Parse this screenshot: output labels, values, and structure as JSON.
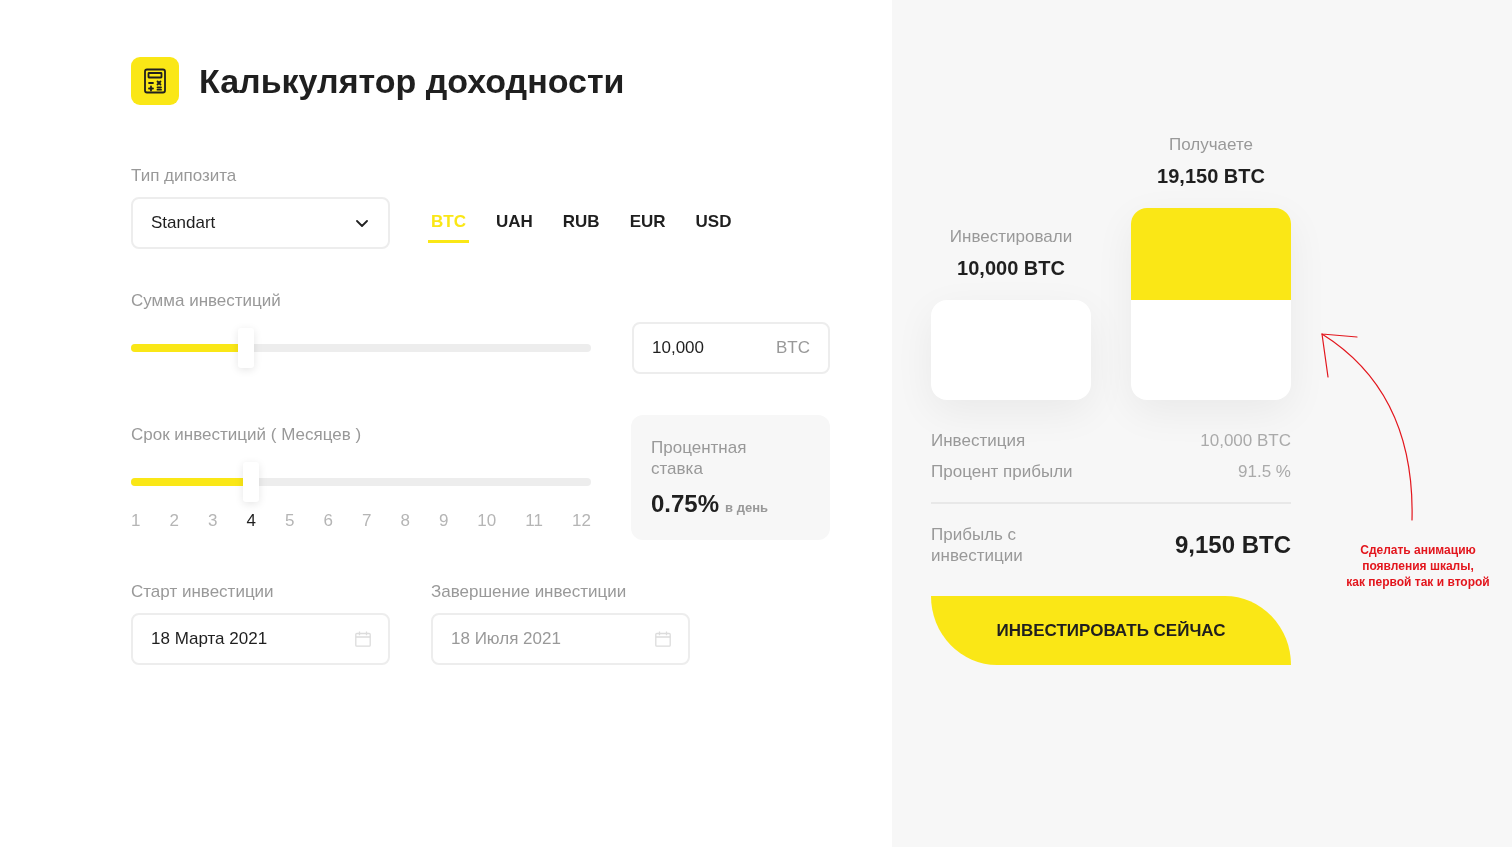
{
  "title": "Калькулятор доходности",
  "deposit": {
    "label": "Тип дипозита",
    "value": "Standart"
  },
  "currencies": [
    {
      "label": "BTC",
      "selected": true
    },
    {
      "label": "UAH",
      "selected": false
    },
    {
      "label": "RUB",
      "selected": false
    },
    {
      "label": "EUR",
      "selected": false
    },
    {
      "label": "USD",
      "selected": false
    }
  ],
  "amount": {
    "label": "Сумма инвестиций",
    "level": 0.25,
    "value": "10,000",
    "unit": "BTC"
  },
  "term": {
    "label": "Срок инвестиций ( Месяцев )",
    "level": 0.26,
    "ticks": [
      {
        "label": "1",
        "selected": false
      },
      {
        "label": "2",
        "selected": false
      },
      {
        "label": "3",
        "selected": false
      },
      {
        "label": "4",
        "selected": true
      },
      {
        "label": "5",
        "selected": false
      },
      {
        "label": "6",
        "selected": false
      },
      {
        "label": "7",
        "selected": false
      },
      {
        "label": "8",
        "selected": false
      },
      {
        "label": "9",
        "selected": false
      },
      {
        "label": "10",
        "selected": false
      },
      {
        "label": "11",
        "selected": false
      },
      {
        "label": "12",
        "selected": false
      }
    ]
  },
  "rate": {
    "label": "Процентная ставка",
    "value": "0.75%",
    "unit": "в день"
  },
  "dates": [
    {
      "label": "Старт инвестиции",
      "value": "18 Марта 2021",
      "disabled": false
    },
    {
      "label": "Завершение инвестиции",
      "value": "18 Июля 2021",
      "disabled": true
    }
  ],
  "result": {
    "columns": [
      {
        "kind": "invested",
        "label": "Инвестировали",
        "value": "10,000 BTC"
      },
      {
        "kind": "received",
        "label": "Получаете",
        "value": "19,150 BTC"
      }
    ],
    "profit": {
      "level": 0.48
    },
    "rows": [
      {
        "label": "Инвестиция",
        "value": "10,000 BTC"
      },
      {
        "label": "Процент прибыли",
        "value": "91.5 %"
      }
    ],
    "total": {
      "label": "Прибыль с инвестиции",
      "value": "9,150 BTC"
    },
    "button": "ИНВЕСТИРОВАТЬ СЕЙЧАС"
  },
  "annotation": {
    "text": "Сделать анимацию\nпоявления шкалы,\nкак первой так и второй"
  }
}
